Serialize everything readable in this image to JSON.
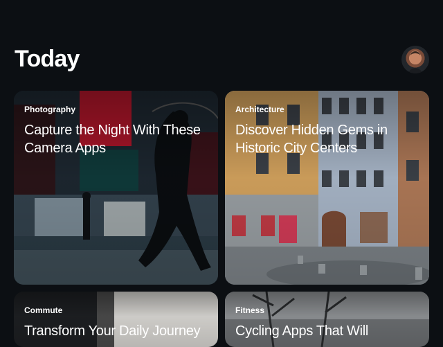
{
  "page": {
    "title": "Today"
  },
  "profile": {
    "avatar_icon": "user-avatar"
  },
  "cards": [
    {
      "category": "Photography",
      "headline": "Capture the Night With These Camera Apps"
    },
    {
      "category": "Architecture",
      "headline": "Discover Hidden Gems in Historic City Centers"
    },
    {
      "category": "Commute",
      "headline": "Transform Your Daily Journey"
    },
    {
      "category": "Fitness",
      "headline": "Cycling Apps That Will"
    }
  ]
}
